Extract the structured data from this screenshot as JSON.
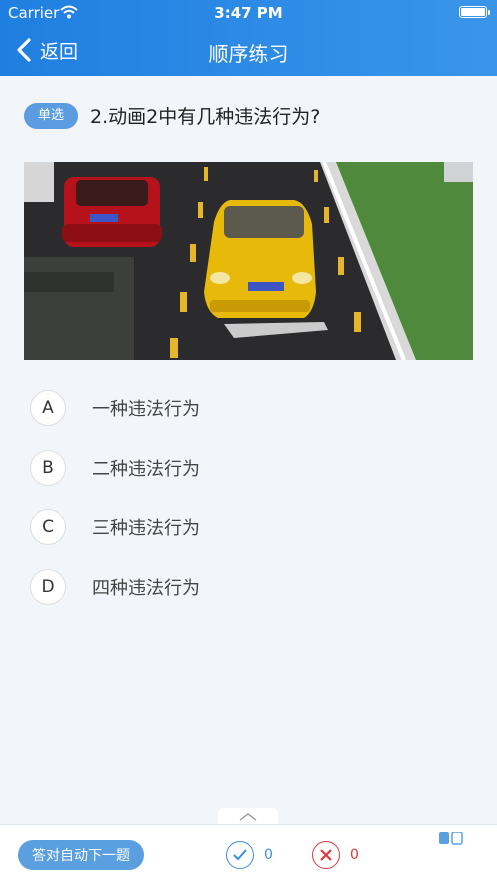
{
  "status_bar": {
    "carrier": "Carrier",
    "time": "3:47 PM"
  },
  "nav": {
    "back_label": "返回",
    "title": "顺序练习"
  },
  "question": {
    "type_badge": "单选",
    "text": "2.动画2中有几种违法行为?"
  },
  "options": [
    {
      "letter": "A",
      "text": "一种违法行为"
    },
    {
      "letter": "B",
      "text": "二种违法行为"
    },
    {
      "letter": "C",
      "text": "三种违法行为"
    },
    {
      "letter": "D",
      "text": "四种违法行为"
    }
  ],
  "bottom_bar": {
    "auto_next_label": "答对自动下一题",
    "correct_count": "0",
    "wrong_count": "0"
  },
  "colors": {
    "header_blue": "#1f7fe0",
    "accent_blue": "#5a9fe0",
    "correct_blue": "#3a8fe0",
    "wrong_red": "#e0383e"
  }
}
